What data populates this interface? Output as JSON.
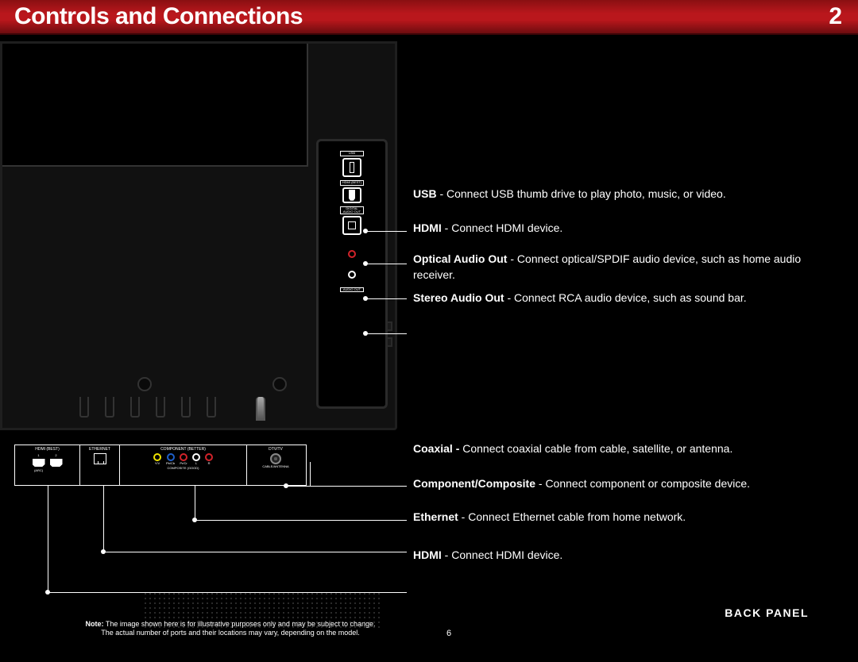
{
  "header": {
    "title": "Controls and Connections",
    "chapter_number": "2"
  },
  "side_panel_labels": {
    "usb": "USB",
    "hdmi": "HDMI (BEST)",
    "digital_audio": "DIGITAL AUDIO OUT",
    "audio_out": "AUDIO OUT"
  },
  "bottom_panel_labels": {
    "hdmi_group": "HDMI (BEST)",
    "hdmi_sub1": "1",
    "hdmi_sub2": "2",
    "hdmi_arc": "(ARC)",
    "ethernet": "ETHERNET",
    "component_group": "COMPONENT (BETTER)",
    "composite_good": "COMPOSITE (GOOD)",
    "ypbpr_y": "Y/V",
    "ypbpr_pb": "Pb/Cb",
    "ypbpr_pr": "Pr/Cr",
    "lr_l": "L",
    "lr_r": "R",
    "dtv": "DTV/TV",
    "cable_ant": "CABLE/ANTENNA"
  },
  "ports": {
    "usb": {
      "title": "USB",
      "body": " - Connect USB thumb drive to play photo, music, or video."
    },
    "hdmi_s": {
      "title": "HDMI",
      "body": " - Connect HDMI device."
    },
    "optical": {
      "title": "Optical Audio Out",
      "body": " - Connect optical/SPDIF audio device, such as home audio receiver."
    },
    "stereo": {
      "title": "Stereo Audio Out",
      "body": " - Connect RCA audio device, such as sound bar."
    },
    "coax": {
      "title": "Coaxial -",
      "body": " Connect coaxial cable from cable, satellite, or antenna."
    },
    "comp": {
      "title": "Component/Composite",
      "body": " - Connect component or composite device."
    },
    "eth": {
      "title": "Ethernet",
      "body": " - Connect Ethernet cable from home network."
    },
    "hdmi_b": {
      "title": "HDMI",
      "body": " - Connect HDMI device."
    }
  },
  "footer": {
    "note_label": "Note:",
    "note_line1": "  The image shown here is for illustrative purposes only and may be subject to change.",
    "note_line2": "The actual number of ports and their locations may vary, depending on the model.",
    "page_number": "6",
    "section_title": "BACK PANEL"
  }
}
